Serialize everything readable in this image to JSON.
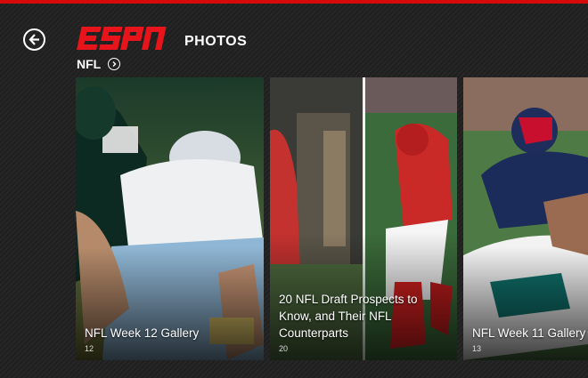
{
  "header": {
    "logo_text": "ESPN",
    "section_title": "PHOTOS",
    "back_icon": "back-arrow-icon",
    "accent_color": "#d60a0a"
  },
  "breadcrumb": {
    "label": "NFL",
    "icon": "chevron-right-circle-icon"
  },
  "galleries": [
    {
      "title": "NFL Week 12 Gallery",
      "count": "12"
    },
    {
      "title": "20 NFL Draft Prospects to Know, and Their NFL Counterparts",
      "count": "20"
    },
    {
      "title": "NFL Week 11 Gallery",
      "count": "13"
    }
  ]
}
